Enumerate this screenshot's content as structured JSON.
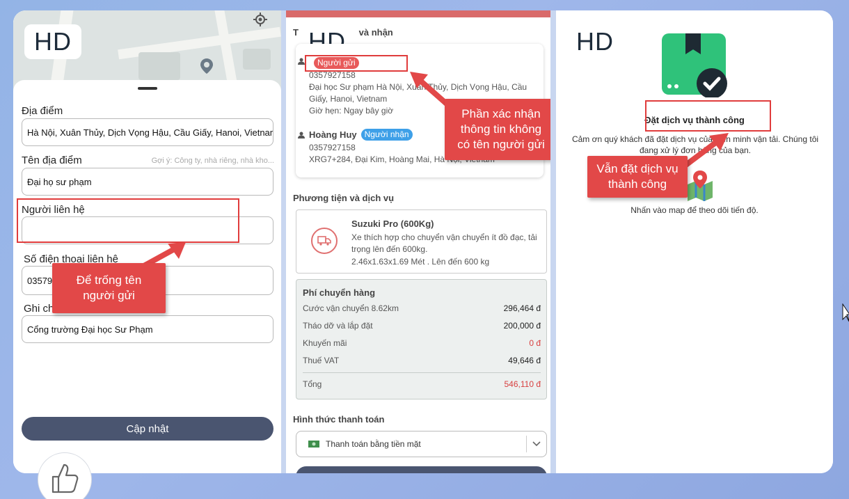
{
  "panel1": {
    "hd": "HD",
    "dia_diem_label": "Địa điểm",
    "dia_diem_value": "Hà Nội, Xuân Thủy, Dịch Vọng Hậu, Cầu Giấy, Hanoi, Vietnam",
    "ten_dia_diem_label": "Tên địa điểm",
    "ten_dia_diem_hint": "Gợi ý: Công ty, nhà riêng, nhà kho...",
    "ten_dia_diem_value": "Đại họ  sư phạm",
    "nguoi_lien_he_label": "Người liên hệ",
    "nguoi_lien_he_value": "",
    "sdt_label": "Số điện thoại liên hệ",
    "sdt_value": "0357927158",
    "ghi_chu_label": "Ghi chú",
    "ghi_chu_value": "Cổng trường Đại học Sư Phạm",
    "update_button": "Cập nhật",
    "callout": [
      "Để trống tên",
      "người gửi"
    ]
  },
  "panel2": {
    "hd": "HD",
    "section_title": "T                        và nhận",
    "sender": {
      "badge": "Người gửi",
      "phone": "0357927158",
      "address": "Đại học Sư phạm Hà Nội, Xuân Thủy, Dịch Vọng Hậu, Cầu Giấy, Hanoi, Vietnam",
      "time": "Giờ hẹn: Ngay bây giờ"
    },
    "receiver": {
      "name": "Hoàng Huy",
      "badge": "Người nhận",
      "phone": "0357927158",
      "address": "XRG7+284, Đại Kim, Hoàng Mai, Hà Nội, Vietnam"
    },
    "callout": [
      "Phần xác nhận",
      "thông tin không",
      "có tên người gửi"
    ],
    "vehicle_section": "Phương tiện và dịch vụ",
    "vehicle": {
      "name": "Suzuki Pro (600Kg)",
      "desc": "Xe thích hợp cho chuyển vận chuyển ít đồ đạc, tải trọng lên đến 600kg.",
      "size": "2.46x1.63x1.69 Mét . Lên đến 600 kg"
    },
    "fee": {
      "title": "Phí chuyển hàng",
      "rows": [
        {
          "label": "Cước vận chuyển 8.62km",
          "value": "296,464 đ"
        },
        {
          "label": "Tháo dỡ và lắp đặt",
          "value": "200,000 đ"
        },
        {
          "label": "Khuyến mãi",
          "value": "0 đ"
        },
        {
          "label": "Thuế VAT",
          "value": "49,646 đ"
        }
      ],
      "total_label": "Tổng",
      "total_value": "546,110 đ"
    },
    "payment_section": "Hình thức thanh toán",
    "payment_value": "Thanh toán bằng tiền mặt"
  },
  "panel3": {
    "hd": "HD",
    "success_title": "Đặt dịch vụ thành công",
    "message": "Cảm ơn quý khách đã đặt dịch vụ của Liên minh vận tải. Chúng tôi đang xử lý đơn hàng của bạn.",
    "callout": [
      "Vẫn đặt dịch vụ",
      "thành công"
    ],
    "map_hint": "Nhấn vào map để theo dõi tiến độ."
  },
  "colors": {
    "accent": "#e24848",
    "primary_button": "#4a5570",
    "success_green": "#2fc27a",
    "receiver_badge": "#3ea0e8"
  }
}
